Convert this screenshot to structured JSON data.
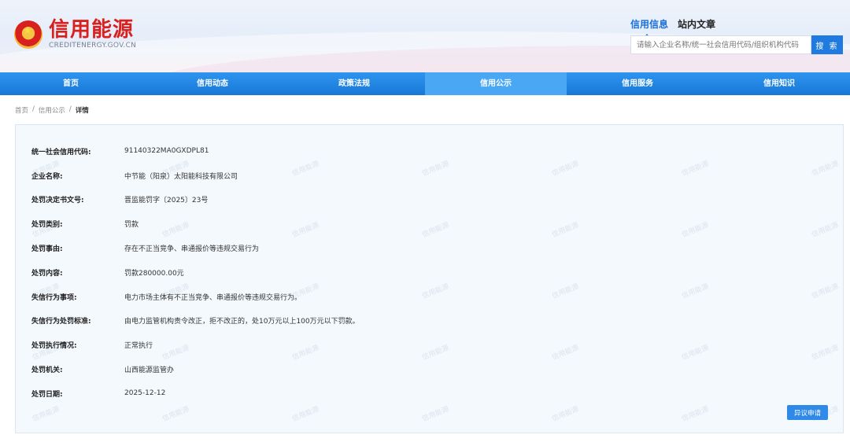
{
  "brand": {
    "title": "信用能源",
    "subtitle": "CREDITENERGY.GOV.CN"
  },
  "search": {
    "tabs": [
      {
        "label": "信用信息",
        "active": true
      },
      {
        "label": "站内文章",
        "active": false
      }
    ],
    "placeholder": "请输入企业名称/统一社会信用代码/组织机构代码",
    "button_label": "搜 索"
  },
  "nav": {
    "items": [
      {
        "label": "首页",
        "active": false
      },
      {
        "label": "信用动态",
        "active": false
      },
      {
        "label": "政策法规",
        "active": false
      },
      {
        "label": "信用公示",
        "active": true
      },
      {
        "label": "信用服务",
        "active": false
      },
      {
        "label": "信用知识",
        "active": false
      }
    ]
  },
  "breadcrumb": {
    "home": "首页",
    "section": "信用公示",
    "current": "详情",
    "separator": "/"
  },
  "detail": {
    "watermark": "信用能源",
    "rows": [
      {
        "label": "统一社会信用代码:",
        "value": "91140322MA0GXDPL81"
      },
      {
        "label": "企业名称:",
        "value": "中节能（阳泉）太阳能科技有限公司"
      },
      {
        "label": "处罚决定书文号:",
        "value": "晋监能罚字〔2025〕23号"
      },
      {
        "label": "处罚类别:",
        "value": "罚款"
      },
      {
        "label": "处罚事由:",
        "value": "存在不正当竞争、串通报价等违规交易行为"
      },
      {
        "label": "处罚内容:",
        "value": "罚款280000.00元"
      },
      {
        "label": "失信行为事项:",
        "value": "电力市场主体有不正当竞争、串通报价等违规交易行为。"
      },
      {
        "label": "失信行为处罚标准:",
        "value": "由电力监管机构责令改正，拒不改正的，处10万元以上100万元以下罚款。"
      },
      {
        "label": "处罚执行情况:",
        "value": "正常执行"
      },
      {
        "label": "处罚机关:",
        "value": "山西能源监管办"
      },
      {
        "label": "处罚日期:",
        "value": "2025-12-12"
      }
    ],
    "objection_button": "异议申请"
  },
  "colors": {
    "brand_red": "#d8201f",
    "nav_blue": "#1877d6",
    "nav_active": "#4aa7f4",
    "accent_blue": "#1f7be0"
  }
}
